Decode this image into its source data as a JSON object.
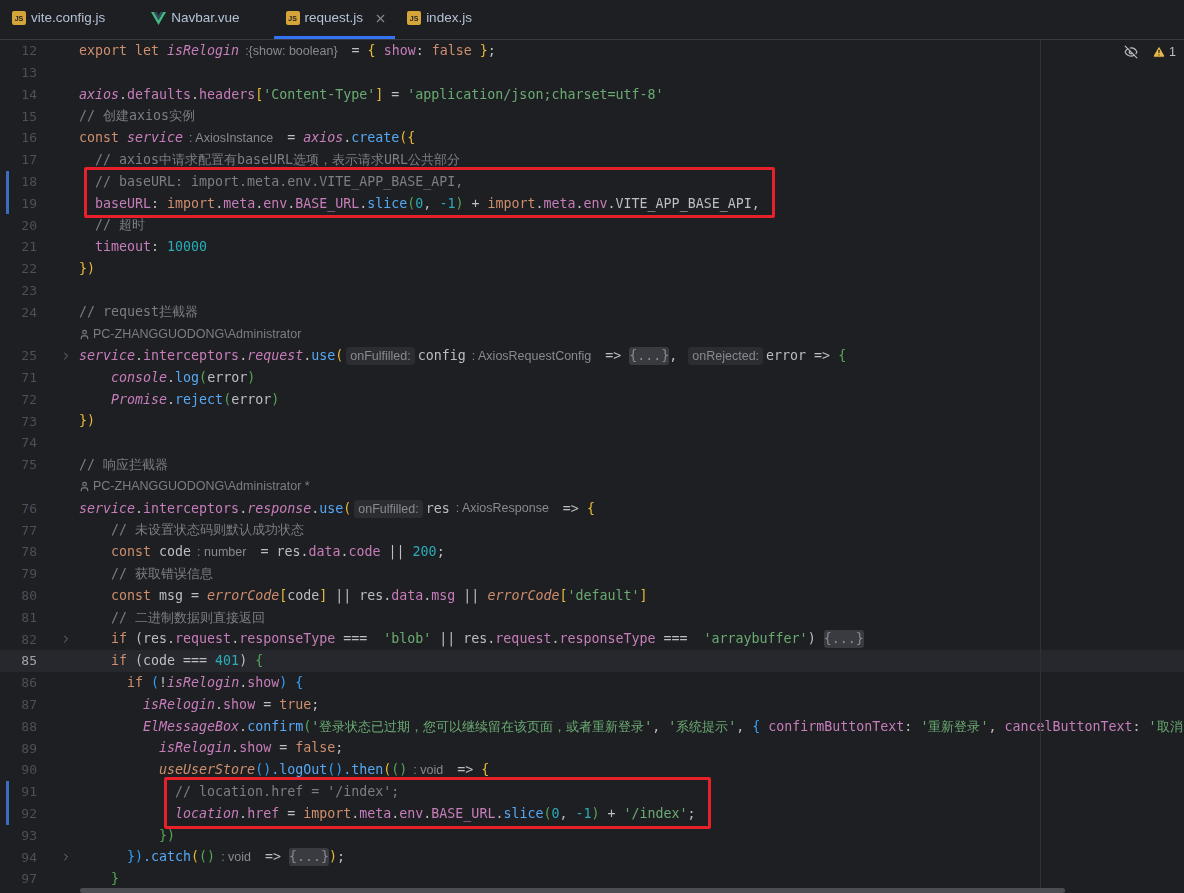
{
  "tabs": [
    {
      "label": "vite.config.js",
      "kind": "js",
      "badge": "JS",
      "selected": false
    },
    {
      "label": "Navbar.vue",
      "kind": "vue",
      "selected": false
    },
    {
      "label": "request.js",
      "kind": "js",
      "badge": "JS",
      "selected": true
    },
    {
      "label": "index.js",
      "kind": "js",
      "badge": "JS",
      "selected": false
    }
  ],
  "inspections": {
    "warnings": "1"
  },
  "lines": [
    {
      "kind": "code",
      "n": "12",
      "changed": false,
      "current": false,
      "folded": false,
      "boxed": false,
      "segs": [
        {
          "kind": "code",
          "parts": [
            {
              "kind": "kw",
              "text": "export let "
            },
            {
              "kind": "glob",
              "text": "isRelogin"
            }
          ]
        },
        {
          "kind": "hint",
          "text": ":{show: boolean}"
        },
        {
          "kind": "code",
          "parts": [
            {
              "kind": "plain",
              "text": " = "
            },
            {
              "kind": "b1",
              "text": "{ "
            },
            {
              "kind": "prop",
              "text": "show"
            },
            {
              "kind": "plain",
              "text": ": "
            },
            {
              "kind": "kw",
              "text": "false"
            },
            {
              "kind": "b1",
              "text": " }"
            },
            {
              "kind": "plain",
              "text": ";"
            }
          ]
        }
      ]
    },
    {
      "kind": "code",
      "n": "13",
      "changed": false,
      "current": false,
      "folded": false,
      "boxed": false
    },
    {
      "kind": "code",
      "n": "14",
      "changed": false,
      "current": false,
      "folded": false,
      "boxed": false,
      "segs": [
        {
          "kind": "code",
          "parts": [
            {
              "kind": "glob",
              "text": "axios"
            },
            {
              "kind": "plain",
              "text": "."
            },
            {
              "kind": "prop",
              "text": "defaults"
            },
            {
              "kind": "plain",
              "text": "."
            },
            {
              "kind": "prop",
              "text": "headers"
            },
            {
              "kind": "b1",
              "text": "["
            },
            {
              "kind": "str",
              "text": "'Content-Type'"
            },
            {
              "kind": "b1",
              "text": "]"
            },
            {
              "kind": "plain",
              "text": " = "
            },
            {
              "kind": "str",
              "text": "'application/json;charset=utf-8'"
            }
          ]
        }
      ]
    },
    {
      "kind": "code",
      "n": "15",
      "changed": false,
      "current": false,
      "folded": false,
      "boxed": false,
      "segs": [
        {
          "kind": "code",
          "parts": [
            {
              "kind": "cmt",
              "text": "// 创建axios实例"
            }
          ]
        }
      ]
    },
    {
      "kind": "code",
      "n": "16",
      "changed": false,
      "current": false,
      "folded": false,
      "boxed": false,
      "segs": [
        {
          "kind": "code",
          "parts": [
            {
              "kind": "kw",
              "text": "const "
            },
            {
              "kind": "glob",
              "text": "service"
            }
          ]
        },
        {
          "kind": "hint",
          "text": ": AxiosInstance"
        },
        {
          "kind": "code",
          "parts": [
            {
              "kind": "plain",
              "text": " = "
            },
            {
              "kind": "glob",
              "text": "axios"
            },
            {
              "kind": "plain",
              "text": "."
            },
            {
              "kind": "fn",
              "text": "create"
            },
            {
              "kind": "b1",
              "text": "({"
            }
          ]
        }
      ]
    },
    {
      "kind": "code",
      "n": "17",
      "changed": false,
      "current": false,
      "folded": false,
      "boxed": false,
      "segs": [
        {
          "kind": "code",
          "parts": [
            {
              "kind": "cmt",
              "text": "  // axios中请求配置有baseURL选项，表示请求URL公共部分"
            }
          ]
        }
      ]
    },
    {
      "kind": "code",
      "n": "18",
      "changed": true,
      "current": false,
      "folded": false,
      "boxed": true,
      "segs": [
        {
          "kind": "code",
          "parts": [
            {
              "kind": "cmt",
              "text": "  // baseURL: import.meta.env.VITE_APP_BASE_API,"
            }
          ]
        }
      ]
    },
    {
      "kind": "code",
      "n": "19",
      "changed": true,
      "current": false,
      "folded": false,
      "boxed": true,
      "segs": [
        {
          "kind": "code",
          "parts": [
            {
              "kind": "prop",
              "text": "  baseURL"
            },
            {
              "kind": "plain",
              "text": ": "
            },
            {
              "kind": "kw",
              "text": "import"
            },
            {
              "kind": "plain",
              "text": "."
            },
            {
              "kind": "prop",
              "text": "meta"
            },
            {
              "kind": "plain",
              "text": "."
            },
            {
              "kind": "prop",
              "text": "env"
            },
            {
              "kind": "plain",
              "text": "."
            },
            {
              "kind": "prop",
              "text": "BASE_URL"
            },
            {
              "kind": "plain",
              "text": "."
            },
            {
              "kind": "fn",
              "text": "slice"
            },
            {
              "kind": "b2",
              "text": "("
            },
            {
              "kind": "num",
              "text": "0"
            },
            {
              "kind": "plain",
              "text": ", "
            },
            {
              "kind": "num",
              "text": "-1"
            },
            {
              "kind": "b2",
              "text": ")"
            },
            {
              "kind": "plain",
              "text": " + "
            },
            {
              "kind": "kw",
              "text": "import"
            },
            {
              "kind": "plain",
              "text": "."
            },
            {
              "kind": "prop",
              "text": "meta"
            },
            {
              "kind": "plain",
              "text": "."
            },
            {
              "kind": "prop",
              "text": "env"
            },
            {
              "kind": "plain",
              "text": ".VITE_APP_BASE_API,"
            }
          ]
        }
      ]
    },
    {
      "kind": "code",
      "n": "20",
      "changed": false,
      "current": false,
      "folded": false,
      "boxed": false,
      "segs": [
        {
          "kind": "code",
          "parts": [
            {
              "kind": "cmt",
              "text": "  // 超时"
            }
          ]
        }
      ]
    },
    {
      "kind": "code",
      "n": "21",
      "changed": false,
      "current": false,
      "folded": false,
      "boxed": false,
      "segs": [
        {
          "kind": "code",
          "parts": [
            {
              "kind": "prop",
              "text": "  timeout"
            },
            {
              "kind": "plain",
              "text": ": "
            },
            {
              "kind": "num",
              "text": "10000"
            }
          ]
        }
      ]
    },
    {
      "kind": "code",
      "n": "22",
      "changed": false,
      "current": false,
      "folded": false,
      "boxed": false,
      "segs": [
        {
          "kind": "code",
          "parts": [
            {
              "kind": "b1",
              "text": "})"
            }
          ]
        }
      ]
    },
    {
      "kind": "code",
      "n": "23",
      "changed": false,
      "current": false,
      "folded": false,
      "boxed": false
    },
    {
      "kind": "code",
      "n": "24",
      "changed": false,
      "current": false,
      "folded": false,
      "boxed": false,
      "segs": [
        {
          "kind": "code",
          "parts": [
            {
              "kind": "cmt",
              "text": "// request拦截器"
            }
          ]
        }
      ]
    },
    {
      "kind": "author",
      "text": "PC-ZHANGGUODONG\\Administrator"
    },
    {
      "kind": "code",
      "n": "25",
      "changed": false,
      "current": false,
      "folded": true,
      "boxed": false,
      "segs": [
        {
          "kind": "code",
          "parts": [
            {
              "kind": "glob",
              "text": "service"
            },
            {
              "kind": "plain",
              "text": "."
            },
            {
              "kind": "prop",
              "text": "interceptors"
            },
            {
              "kind": "plain",
              "text": "."
            },
            {
              "kind": "glob",
              "text": "request"
            },
            {
              "kind": "plain",
              "text": "."
            },
            {
              "kind": "fn",
              "text": "use"
            },
            {
              "kind": "b1",
              "text": "("
            }
          ]
        },
        {
          "kind": "param",
          "text": "onFulfilled:"
        },
        {
          "kind": "code",
          "parts": [
            {
              "kind": "plain",
              "text": "config"
            }
          ]
        },
        {
          "kind": "hint",
          "text": ": AxiosRequestConfig"
        },
        {
          "kind": "code",
          "parts": [
            {
              "kind": "plain",
              "text": " => "
            }
          ]
        },
        {
          "kind": "fold",
          "text": "{...}"
        },
        {
          "kind": "code",
          "parts": [
            {
              "kind": "plain",
              "text": ", "
            }
          ]
        },
        {
          "kind": "param",
          "text": "onRejected:"
        },
        {
          "kind": "code",
          "parts": [
            {
              "kind": "plain",
              "text": "error => "
            },
            {
              "kind": "b2",
              "text": "{"
            }
          ]
        }
      ]
    },
    {
      "kind": "code",
      "n": "71",
      "changed": false,
      "current": false,
      "folded": false,
      "boxed": false,
      "segs": [
        {
          "kind": "code",
          "parts": [
            {
              "kind": "glob",
              "text": "    console"
            },
            {
              "kind": "plain",
              "text": "."
            },
            {
              "kind": "fn",
              "text": "log"
            },
            {
              "kind": "b2",
              "text": "("
            },
            {
              "kind": "plain",
              "text": "error"
            },
            {
              "kind": "b2",
              "text": ")"
            }
          ]
        }
      ]
    },
    {
      "kind": "code",
      "n": "72",
      "changed": false,
      "current": false,
      "folded": false,
      "boxed": false,
      "segs": [
        {
          "kind": "code",
          "parts": [
            {
              "kind": "glob",
              "text": "    Promise"
            },
            {
              "kind": "plain",
              "text": "."
            },
            {
              "kind": "fn",
              "text": "reject"
            },
            {
              "kind": "b2",
              "text": "("
            },
            {
              "kind": "plain",
              "text": "error"
            },
            {
              "kind": "b2",
              "text": ")"
            }
          ]
        }
      ]
    },
    {
      "kind": "code",
      "n": "73",
      "changed": false,
      "current": false,
      "folded": false,
      "boxed": false,
      "segs": [
        {
          "kind": "code",
          "parts": [
            {
              "kind": "b1",
              "text": "})"
            }
          ]
        }
      ]
    },
    {
      "kind": "code",
      "n": "74",
      "changed": false,
      "current": false,
      "folded": false,
      "boxed": false
    },
    {
      "kind": "code",
      "n": "75",
      "changed": false,
      "current": false,
      "folded": false,
      "boxed": false,
      "segs": [
        {
          "kind": "code",
          "parts": [
            {
              "kind": "cmt",
              "text": "// 响应拦截器"
            }
          ]
        }
      ]
    },
    {
      "kind": "author",
      "text": "PC-ZHANGGUODONG\\Administrator *"
    },
    {
      "kind": "code",
      "n": "76",
      "changed": false,
      "current": false,
      "folded": false,
      "boxed": false,
      "segs": [
        {
          "kind": "code",
          "parts": [
            {
              "kind": "glob",
              "text": "service"
            },
            {
              "kind": "plain",
              "text": "."
            },
            {
              "kind": "prop",
              "text": "interceptors"
            },
            {
              "kind": "plain",
              "text": "."
            },
            {
              "kind": "glob",
              "text": "response"
            },
            {
              "kind": "plain",
              "text": "."
            },
            {
              "kind": "fn",
              "text": "use"
            },
            {
              "kind": "b1",
              "text": "("
            }
          ]
        },
        {
          "kind": "param",
          "text": "onFulfilled:"
        },
        {
          "kind": "code",
          "parts": [
            {
              "kind": "plain",
              "text": "res"
            }
          ]
        },
        {
          "kind": "hint",
          "text": ": AxiosResponse"
        },
        {
          "kind": "code",
          "parts": [
            {
              "kind": "plain",
              "text": " => "
            },
            {
              "kind": "b1",
              "text": "{"
            }
          ]
        }
      ]
    },
    {
      "kind": "code",
      "n": "77",
      "changed": false,
      "current": false,
      "folded": false,
      "boxed": false,
      "segs": [
        {
          "kind": "code",
          "parts": [
            {
              "kind": "cmt",
              "text": "    // 未设置状态码则默认成功状态"
            }
          ]
        }
      ]
    },
    {
      "kind": "code",
      "n": "78",
      "changed": false,
      "current": false,
      "folded": false,
      "boxed": false,
      "segs": [
        {
          "kind": "code",
          "parts": [
            {
              "kind": "kw",
              "text": "    const "
            },
            {
              "kind": "plain",
              "text": "code"
            }
          ]
        },
        {
          "kind": "hint",
          "text": ": number"
        },
        {
          "kind": "code",
          "parts": [
            {
              "kind": "plain",
              "text": " = res."
            },
            {
              "kind": "prop",
              "text": "data"
            },
            {
              "kind": "plain",
              "text": "."
            },
            {
              "kind": "prop",
              "text": "code"
            },
            {
              "kind": "plain",
              "text": " || "
            },
            {
              "kind": "num",
              "text": "200"
            },
            {
              "kind": "plain",
              "text": ";"
            }
          ]
        }
      ]
    },
    {
      "kind": "code",
      "n": "79",
      "changed": false,
      "current": false,
      "folded": false,
      "boxed": false,
      "segs": [
        {
          "kind": "code",
          "parts": [
            {
              "kind": "cmt",
              "text": "    // 获取错误信息"
            }
          ]
        }
      ]
    },
    {
      "kind": "code",
      "n": "80",
      "changed": false,
      "current": false,
      "folded": false,
      "boxed": false,
      "segs": [
        {
          "kind": "code",
          "parts": [
            {
              "kind": "kw",
              "text": "    const "
            },
            {
              "kind": "plain",
              "text": "msg = "
            },
            {
              "kind": "gvar",
              "text": "errorCode"
            },
            {
              "kind": "b1",
              "text": "["
            },
            {
              "kind": "plain",
              "text": "code"
            },
            {
              "kind": "b1",
              "text": "]"
            },
            {
              "kind": "plain",
              "text": " || res."
            },
            {
              "kind": "prop",
              "text": "data"
            },
            {
              "kind": "plain",
              "text": "."
            },
            {
              "kind": "prop",
              "text": "msg"
            },
            {
              "kind": "plain",
              "text": " || "
            },
            {
              "kind": "gvar",
              "text": "errorCode"
            },
            {
              "kind": "b1",
              "text": "["
            },
            {
              "kind": "str",
              "text": "'default'"
            },
            {
              "kind": "b1",
              "text": "]"
            }
          ]
        }
      ]
    },
    {
      "kind": "code",
      "n": "81",
      "changed": false,
      "current": false,
      "folded": false,
      "boxed": false,
      "segs": [
        {
          "kind": "code",
          "parts": [
            {
              "kind": "cmt",
              "text": "    // 二进制数据则直接返回"
            }
          ]
        }
      ]
    },
    {
      "kind": "code",
      "n": "82",
      "changed": false,
      "current": false,
      "folded": true,
      "boxed": false,
      "segs": [
        {
          "kind": "code",
          "parts": [
            {
              "kind": "kw",
              "text": "    if "
            },
            {
              "kind": "plain",
              "text": "(res."
            },
            {
              "kind": "prop",
              "text": "request"
            },
            {
              "kind": "plain",
              "text": "."
            },
            {
              "kind": "prop",
              "text": "responseType"
            },
            {
              "kind": "plain",
              "text": " ===  "
            },
            {
              "kind": "str",
              "text": "'blob'"
            },
            {
              "kind": "plain",
              "text": " || res."
            },
            {
              "kind": "prop",
              "text": "request"
            },
            {
              "kind": "plain",
              "text": "."
            },
            {
              "kind": "prop",
              "text": "responseType"
            },
            {
              "kind": "plain",
              "text": " ===  "
            },
            {
              "kind": "str",
              "text": "'arraybuffer'"
            },
            {
              "kind": "plain",
              "text": ") "
            }
          ]
        },
        {
          "kind": "fold",
          "text": "{...}"
        }
      ]
    },
    {
      "kind": "code",
      "n": "85",
      "changed": false,
      "current": true,
      "folded": false,
      "boxed": false,
      "segs": [
        {
          "kind": "code",
          "parts": [
            {
              "kind": "kw",
              "text": "    if "
            },
            {
              "kind": "plain",
              "text": "(code === "
            },
            {
              "kind": "num",
              "text": "401"
            },
            {
              "kind": "plain",
              "text": ") "
            },
            {
              "kind": "b2",
              "text": "{"
            }
          ]
        }
      ]
    },
    {
      "kind": "code",
      "n": "86",
      "changed": false,
      "current": false,
      "folded": false,
      "boxed": false,
      "segs": [
        {
          "kind": "code",
          "parts": [
            {
              "kind": "kw",
              "text": "      if "
            },
            {
              "kind": "b3",
              "text": "("
            },
            {
              "kind": "plain",
              "text": "!"
            },
            {
              "kind": "glob",
              "text": "isRelogin"
            },
            {
              "kind": "plain",
              "text": "."
            },
            {
              "kind": "prop",
              "text": "show"
            },
            {
              "kind": "b3",
              "text": ") {"
            }
          ]
        }
      ]
    },
    {
      "kind": "code",
      "n": "87",
      "changed": false,
      "current": false,
      "folded": false,
      "boxed": false,
      "segs": [
        {
          "kind": "code",
          "parts": [
            {
              "kind": "glob",
              "text": "        isRelogin"
            },
            {
              "kind": "plain",
              "text": "."
            },
            {
              "kind": "prop",
              "text": "show"
            },
            {
              "kind": "plain",
              "text": " = "
            },
            {
              "kind": "kw",
              "text": "true"
            },
            {
              "kind": "plain",
              "text": ";"
            }
          ]
        }
      ]
    },
    {
      "kind": "code",
      "n": "88",
      "changed": false,
      "current": false,
      "folded": false,
      "boxed": false,
      "segs": [
        {
          "kind": "code",
          "parts": [
            {
              "kind": "glob",
              "text": "        ElMessageBox"
            },
            {
              "kind": "plain",
              "text": "."
            },
            {
              "kind": "fn",
              "text": "confirm"
            },
            {
              "kind": "b2",
              "text": "("
            },
            {
              "kind": "str",
              "text": "'登录状态已过期，您可以继续留在该页面，或者重新登录'"
            },
            {
              "kind": "plain",
              "text": ", "
            },
            {
              "kind": "str",
              "text": "'系统提示'"
            },
            {
              "kind": "plain",
              "text": ", "
            },
            {
              "kind": "b3",
              "text": "{ "
            },
            {
              "kind": "prop",
              "text": "confirmButtonText"
            },
            {
              "kind": "plain",
              "text": ": "
            },
            {
              "kind": "str",
              "text": "'重新登录'"
            },
            {
              "kind": "plain",
              "text": ", "
            },
            {
              "kind": "prop",
              "text": "cancelButtonText"
            },
            {
              "kind": "plain",
              "text": ": "
            },
            {
              "kind": "str",
              "text": "'取消"
            }
          ]
        }
      ]
    },
    {
      "kind": "code",
      "n": "89",
      "changed": false,
      "current": false,
      "folded": false,
      "boxed": false,
      "segs": [
        {
          "kind": "code",
          "parts": [
            {
              "kind": "glob",
              "text": "          isRelogin"
            },
            {
              "kind": "plain",
              "text": "."
            },
            {
              "kind": "prop",
              "text": "show"
            },
            {
              "kind": "plain",
              "text": " = "
            },
            {
              "kind": "kw",
              "text": "false"
            },
            {
              "kind": "plain",
              "text": ";"
            }
          ]
        }
      ]
    },
    {
      "kind": "code",
      "n": "90",
      "changed": false,
      "current": false,
      "folded": false,
      "boxed": false,
      "segs": [
        {
          "kind": "code",
          "parts": [
            {
              "kind": "gvar",
              "text": "          useUserStore"
            },
            {
              "kind": "b3",
              "text": "()"
            },
            {
              "kind": "fn",
              "text": ".logOut"
            },
            {
              "kind": "b3",
              "text": "()"
            },
            {
              "kind": "fn",
              "text": ".then"
            },
            {
              "kind": "b1",
              "text": "("
            },
            {
              "kind": "b2",
              "text": "()"
            }
          ]
        },
        {
          "kind": "hint",
          "text": ": void"
        },
        {
          "kind": "code",
          "parts": [
            {
              "kind": "plain",
              "text": " => "
            },
            {
              "kind": "b1",
              "text": "{"
            }
          ]
        }
      ]
    },
    {
      "kind": "code",
      "n": "91",
      "changed": true,
      "current": false,
      "folded": false,
      "boxed": true,
      "segs": [
        {
          "kind": "code",
          "parts": [
            {
              "kind": "cmt",
              "text": "            // location.href = '/index';"
            }
          ]
        }
      ]
    },
    {
      "kind": "code",
      "n": "92",
      "changed": true,
      "current": false,
      "folded": false,
      "boxed": true,
      "segs": [
        {
          "kind": "code",
          "parts": [
            {
              "kind": "glob",
              "text": "            location"
            },
            {
              "kind": "plain",
              "text": "."
            },
            {
              "kind": "prop",
              "text": "href"
            },
            {
              "kind": "plain",
              "text": " = "
            },
            {
              "kind": "kw",
              "text": "import"
            },
            {
              "kind": "plain",
              "text": "."
            },
            {
              "kind": "prop",
              "text": "meta"
            },
            {
              "kind": "plain",
              "text": "."
            },
            {
              "kind": "prop",
              "text": "env"
            },
            {
              "kind": "plain",
              "text": "."
            },
            {
              "kind": "prop",
              "text": "BASE_URL"
            },
            {
              "kind": "plain",
              "text": "."
            },
            {
              "kind": "fn",
              "text": "slice"
            },
            {
              "kind": "b2",
              "text": "("
            },
            {
              "kind": "num",
              "text": "0"
            },
            {
              "kind": "plain",
              "text": ", "
            },
            {
              "kind": "num",
              "text": "-1"
            },
            {
              "kind": "b2",
              "text": ")"
            },
            {
              "kind": "plain",
              "text": " + "
            },
            {
              "kind": "str",
              "text": "'/index'"
            },
            {
              "kind": "plain",
              "text": ";"
            }
          ]
        }
      ]
    },
    {
      "kind": "code",
      "n": "93",
      "changed": false,
      "current": false,
      "folded": false,
      "boxed": false,
      "segs": [
        {
          "kind": "code",
          "parts": [
            {
              "kind": "b2",
              "text": "          })"
            }
          ]
        }
      ]
    },
    {
      "kind": "code",
      "n": "94",
      "changed": false,
      "current": false,
      "folded": true,
      "boxed": false,
      "segs": [
        {
          "kind": "code",
          "parts": [
            {
              "kind": "b3",
              "text": "      })"
            },
            {
              "kind": "fn",
              "text": ".catch"
            },
            {
              "kind": "b1",
              "text": "("
            },
            {
              "kind": "b2",
              "text": "()"
            }
          ]
        },
        {
          "kind": "hint",
          "text": ": void"
        },
        {
          "kind": "code",
          "parts": [
            {
              "kind": "plain",
              "text": " => "
            }
          ]
        },
        {
          "kind": "fold",
          "text": "{...}"
        },
        {
          "kind": "code",
          "parts": [
            {
              "kind": "b1",
              "text": ")"
            },
            {
              "kind": "plain",
              "text": ";"
            }
          ]
        }
      ]
    },
    {
      "kind": "code",
      "n": "97",
      "changed": false,
      "current": false,
      "folded": false,
      "boxed": false,
      "segs": [
        {
          "kind": "code",
          "parts": [
            {
              "kind": "b2",
              "text": "    }"
            }
          ]
        }
      ]
    }
  ]
}
